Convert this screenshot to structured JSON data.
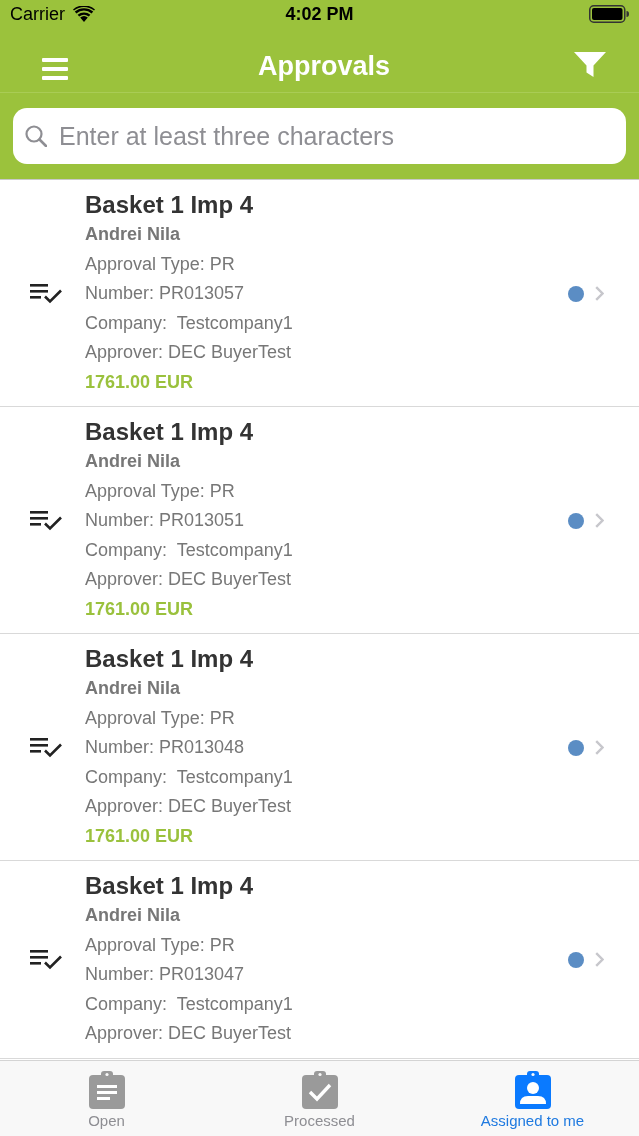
{
  "status_bar": {
    "carrier": "Carrier",
    "time": "4:02 PM"
  },
  "nav_bar": {
    "title": "Approvals"
  },
  "search": {
    "placeholder": "Enter at least three characters"
  },
  "approvals": [
    {
      "title": "Basket 1 Imp 4",
      "requester": "Andrei Nila",
      "details": [
        "Approval Type: PR",
        "Number: PR013057",
        "Company:  Testcompany1",
        "Approver: DEC BuyerTest"
      ],
      "amount": "1761.00 EUR",
      "unread": true
    },
    {
      "title": "Basket 1 Imp 4",
      "requester": "Andrei Nila",
      "details": [
        "Approval Type: PR",
        "Number: PR013051",
        "Company:  Testcompany1",
        "Approver: DEC BuyerTest"
      ],
      "amount": "1761.00 EUR",
      "unread": true
    },
    {
      "title": "Basket 1 Imp 4",
      "requester": "Andrei Nila",
      "details": [
        "Approval Type: PR",
        "Number: PR013048",
        "Company:  Testcompany1",
        "Approver: DEC BuyerTest"
      ],
      "amount": "1761.00 EUR",
      "unread": true
    },
    {
      "title": "Basket 1 Imp 4",
      "requester": "Andrei Nila",
      "details": [
        "Approval Type: PR",
        "Number: PR013047",
        "Company:  Testcompany1",
        "Approver: DEC BuyerTest"
      ],
      "unread": true
    }
  ],
  "tabs": [
    {
      "label": "Open",
      "selected": false
    },
    {
      "label": "Processed",
      "selected": false
    },
    {
      "label": "Assigned to me",
      "selected": true
    }
  ]
}
